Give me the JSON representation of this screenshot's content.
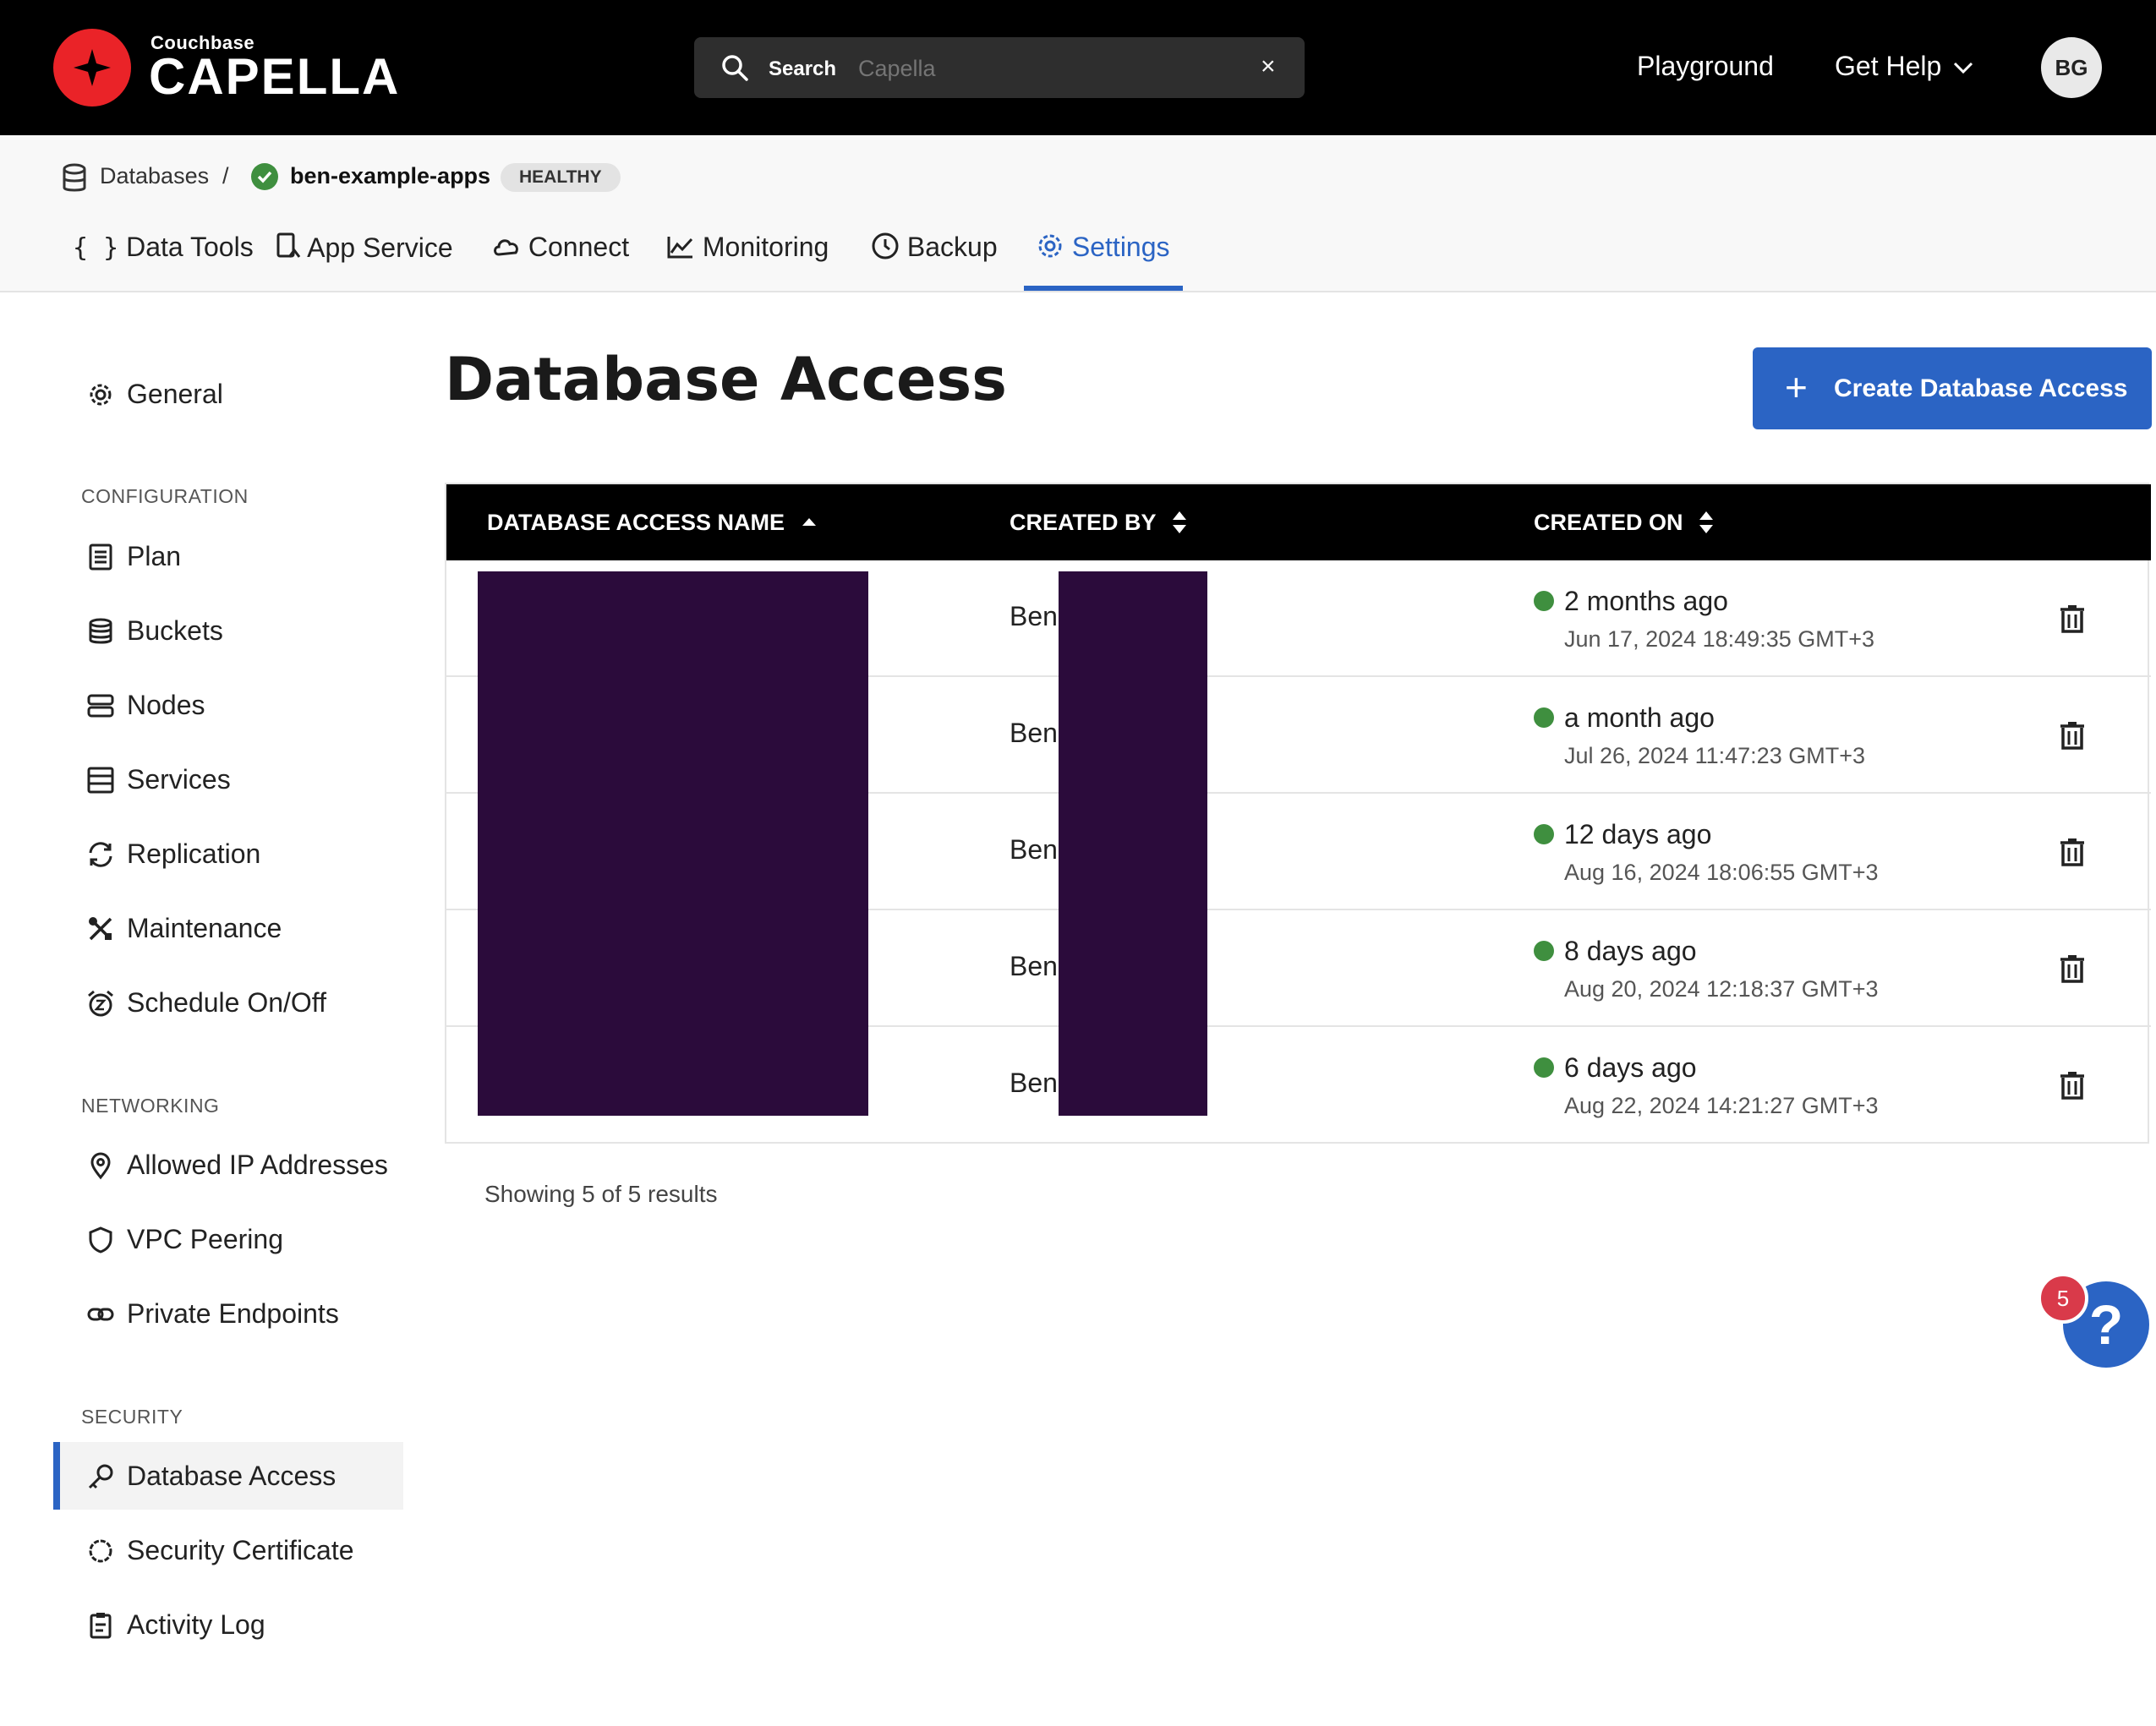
{
  "header": {
    "logo_small": "Couchbase",
    "logo_big": "CAPELLA",
    "search_label": "Search",
    "search_placeholder": "Capella",
    "search_clear": "×",
    "playground": "Playground",
    "get_help": "Get Help",
    "avatar_initials": "BG"
  },
  "breadcrumb": {
    "databases": "Databases",
    "separator": "/",
    "database_name": "ben-example-apps",
    "status": "HEALTHY"
  },
  "tabs": [
    {
      "label": "Data Tools",
      "icon": "braces-icon"
    },
    {
      "label": "App Service",
      "icon": "app-service-icon"
    },
    {
      "label": "Connect",
      "icon": "cloud-icon"
    },
    {
      "label": "Monitoring",
      "icon": "line-chart-icon"
    },
    {
      "label": "Backup",
      "icon": "clock-icon"
    },
    {
      "label": "Settings",
      "icon": "gear-icon",
      "active": true
    }
  ],
  "sidebar": {
    "general": "General",
    "configuration_heading": "CONFIGURATION",
    "configuration": [
      "Plan",
      "Buckets",
      "Nodes",
      "Services",
      "Replication",
      "Maintenance",
      "Schedule On/Off"
    ],
    "networking_heading": "NETWORKING",
    "networking": [
      "Allowed IP Addresses",
      "VPC Peering",
      "Private Endpoints"
    ],
    "security_heading": "SECURITY",
    "security": [
      "Database Access",
      "Security Certificate",
      "Activity Log"
    ],
    "active_item": "Database Access"
  },
  "main": {
    "title": "Database Access",
    "create_button": "Create Database Access",
    "columns": [
      "DATABASE ACCESS NAME",
      "CREATED BY",
      "CREATED ON"
    ],
    "sort": {
      "name": "ascending",
      "created_by": "unsorted",
      "created_on": "unsorted"
    },
    "rows": [
      {
        "created_by": "Ben",
        "relative": "2 months ago",
        "absolute": "Jun 17, 2024 18:49:35 GMT+3"
      },
      {
        "created_by": "Ben",
        "relative": "a month ago",
        "absolute": "Jul 26, 2024 11:47:23 GMT+3"
      },
      {
        "created_by": "Ben",
        "relative": "12 days ago",
        "absolute": "Aug 16, 2024 18:06:55 GMT+3"
      },
      {
        "created_by": "Ben",
        "relative": "8 days ago",
        "absolute": "Aug 20, 2024 12:18:37 GMT+3"
      },
      {
        "created_by": "Ben",
        "relative": "6 days ago",
        "absolute": "Aug 22, 2024 14:21:27 GMT+3"
      }
    ],
    "showing": "Showing 5 of 5 results"
  },
  "help_widget": {
    "symbol": "?",
    "badge": "5"
  },
  "colors": {
    "accent": "#2b64c4",
    "brand": "#ea2328",
    "healthy": "#3f8f3f",
    "redaction": "#2b0b3b"
  }
}
